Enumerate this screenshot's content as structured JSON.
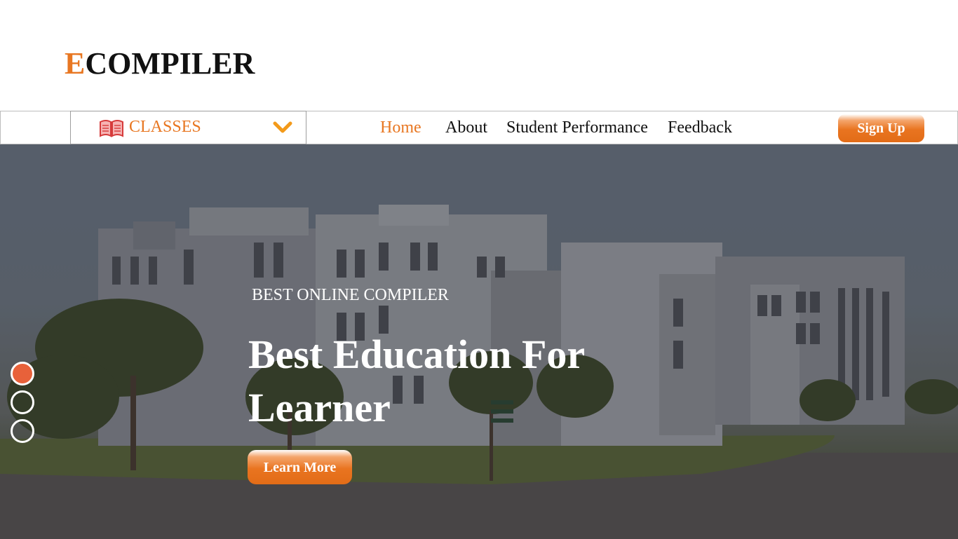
{
  "brand": {
    "logo_first": "E",
    "logo_rest": "COMPILER"
  },
  "nav": {
    "classes_label": "CLASSES",
    "links": [
      {
        "label": "Home",
        "active": true
      },
      {
        "label": "About",
        "active": false
      },
      {
        "label": "Student Performance",
        "active": false
      },
      {
        "label": "Feedback",
        "active": false
      }
    ],
    "signup_label": "Sign Up"
  },
  "hero": {
    "kicker": "BEST ONLINE COMPILER",
    "title": "Best Education For Learner",
    "button_label": "Learn More",
    "slides_total": 3,
    "active_slide": 1
  },
  "icons": {
    "classes": "book-icon",
    "dropdown": "chevron-down-icon"
  },
  "colors": {
    "accent": "#e87722",
    "slide_active": "#e8613a",
    "text_dark": "#111111"
  }
}
